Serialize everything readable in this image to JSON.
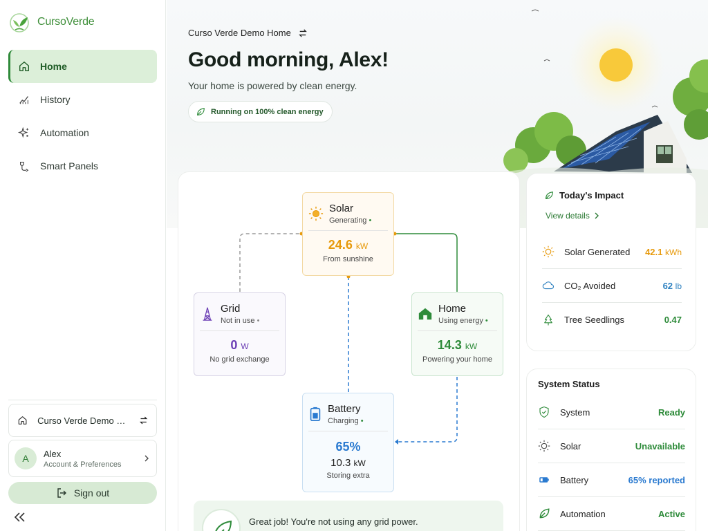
{
  "brand": {
    "name": "CursoVerde"
  },
  "sidebar": {
    "items": [
      {
        "label": "Home",
        "icon": "home-icon",
        "active": true
      },
      {
        "label": "History",
        "icon": "chart-line-icon",
        "active": false
      },
      {
        "label": "Automation",
        "icon": "sparkle-icon",
        "active": false
      },
      {
        "label": "Smart Panels",
        "icon": "plug-icon",
        "active": false
      }
    ],
    "home_selector": "Curso Verde Demo Ho...",
    "account": {
      "initial": "A",
      "name": "Alex",
      "subtitle": "Account & Preferences"
    },
    "signout_label": "Sign out"
  },
  "header": {
    "breadcrumb": "Curso Verde Demo Home",
    "greeting": "Good morning, Alex!",
    "subtitle": "Your home is powered by clean energy.",
    "pill": "Running on 100% clean energy"
  },
  "flow": {
    "solar": {
      "title": "Solar",
      "state": "Generating",
      "value": "24.6",
      "unit": "kW",
      "note": "From sunshine",
      "color": "#e79a0c"
    },
    "grid": {
      "title": "Grid",
      "state": "Not in use",
      "value": "0",
      "unit": "W",
      "note": "No grid exchange",
      "color": "#6c3fb5"
    },
    "home": {
      "title": "Home",
      "state": "Using energy",
      "value": "14.3",
      "unit": "kW",
      "note": "Powering your home",
      "color": "#2e8b3a"
    },
    "battery": {
      "title": "Battery",
      "state": "Charging",
      "percent": "65%",
      "value": "10.3",
      "unit": "kW",
      "note": "Storing extra",
      "color": "#2a7ad0"
    },
    "status_dot": "•"
  },
  "message": {
    "text": "Great job! You're not using any grid power."
  },
  "impact": {
    "title": "Today's Impact",
    "view_details": "View details",
    "rows": [
      {
        "label": "Solar Generated",
        "value": "42.1",
        "unit": "kWh",
        "color": "#e79a0c",
        "icon": "sun-icon"
      },
      {
        "label": "CO₂ Avoided",
        "value": "62",
        "unit": "lb",
        "color": "#2b7fbf",
        "icon": "cloud-icon"
      },
      {
        "label": "Tree Seedlings",
        "value": "0.47",
        "unit": "",
        "color": "#2e8b3a",
        "icon": "tree-icon"
      }
    ]
  },
  "status": {
    "title": "System Status",
    "rows": [
      {
        "label": "System",
        "value": "Ready",
        "color": "#2e8b3a",
        "icon": "shield-check-icon"
      },
      {
        "label": "Solar",
        "value": "Unavailable",
        "color": "#2e8b3a",
        "icon": "sun-icon"
      },
      {
        "label": "Battery",
        "value": "65% reported",
        "color": "#2a7ad0",
        "icon": "battery-icon"
      },
      {
        "label": "Automation",
        "value": "Active",
        "color": "#2e8b3a",
        "icon": "leaf-icon"
      }
    ]
  }
}
